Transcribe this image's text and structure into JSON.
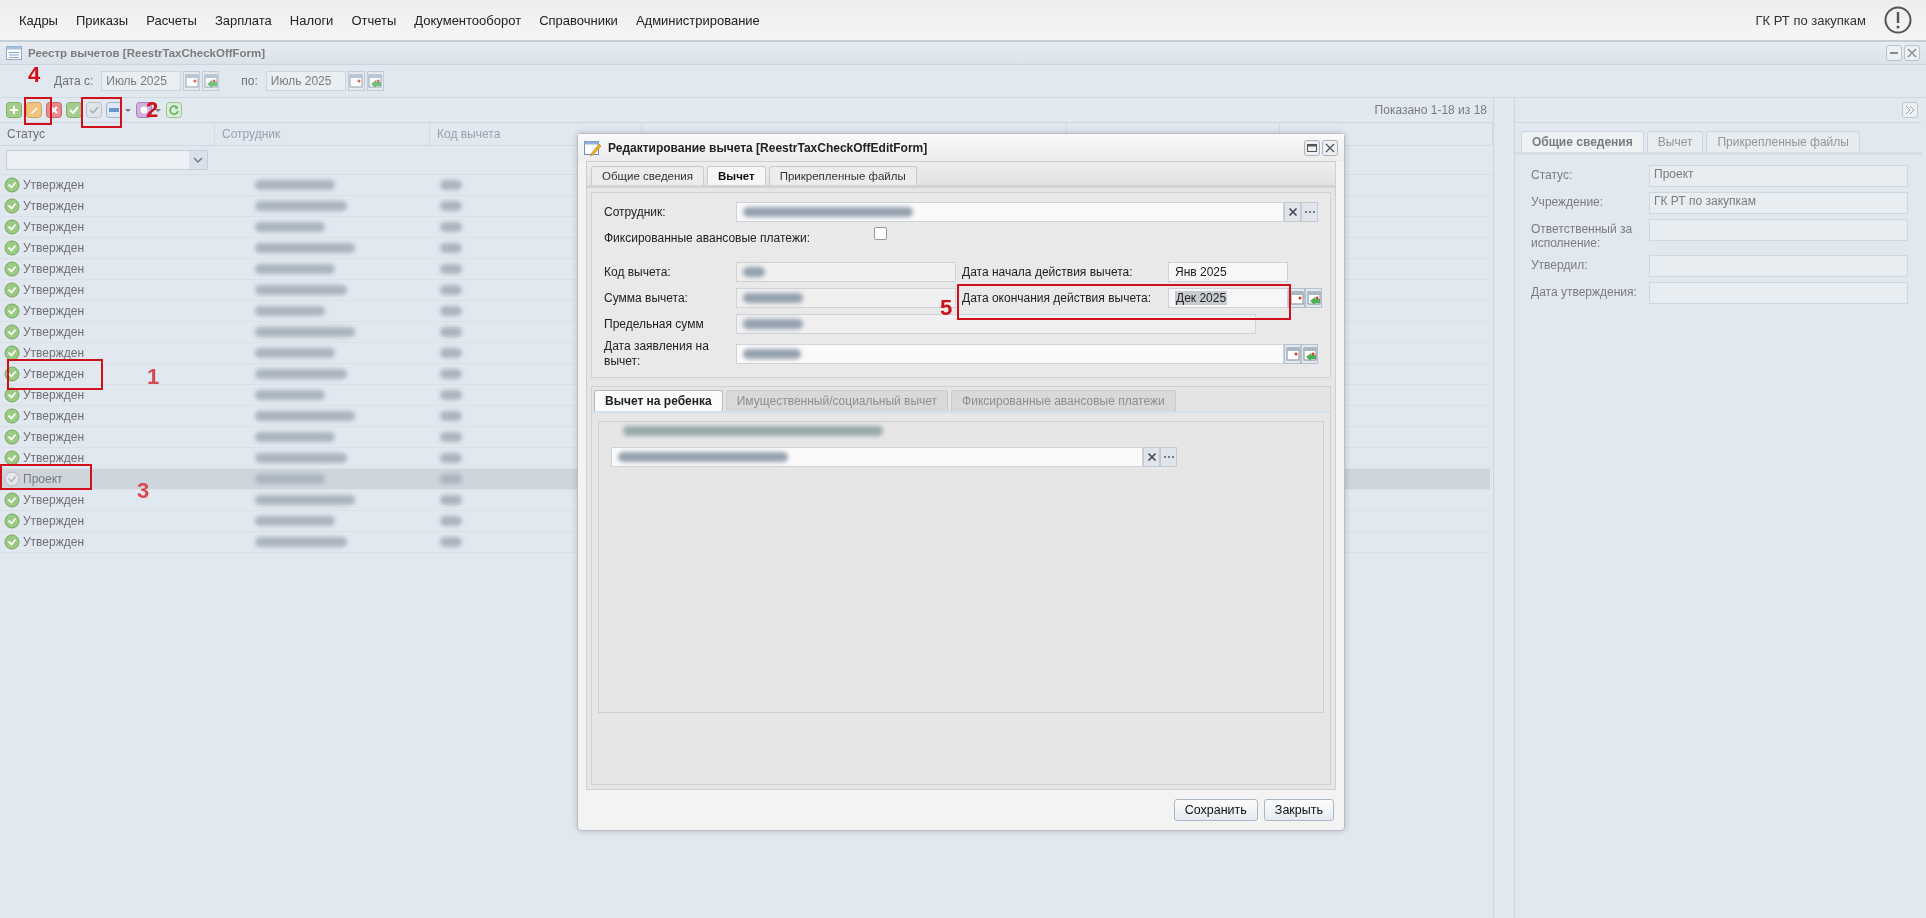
{
  "menu": {
    "items": [
      "Кадры",
      "Приказы",
      "Расчеты",
      "Зарплата",
      "Налоги",
      "Отчеты",
      "Документооборот",
      "Справочники",
      "Администрирование"
    ],
    "org": "ГК РТ по закупкам"
  },
  "registry_window": {
    "title": "Реестр вычетов [ReestrTaxCheckOffForm]",
    "date_from_label": "Дата с:",
    "date_from": "Июль 2025",
    "date_to_label": "по:",
    "date_to": "Июль 2025",
    "paging": "Показано 1-18 из 18",
    "columns": [
      "Статус",
      "Сотрудник",
      "Код вычета"
    ],
    "rows": [
      {
        "status": "Утвержден",
        "kind": "approved",
        "selected": false
      },
      {
        "status": "Утвержден",
        "kind": "approved",
        "selected": false
      },
      {
        "status": "Утвержден",
        "kind": "approved",
        "selected": false
      },
      {
        "status": "Утвержден",
        "kind": "approved",
        "selected": false
      },
      {
        "status": "Утвержден",
        "kind": "approved",
        "selected": false
      },
      {
        "status": "Утвержден",
        "kind": "approved",
        "selected": false
      },
      {
        "status": "Утвержден",
        "kind": "approved",
        "selected": false
      },
      {
        "status": "Утвержден",
        "kind": "approved",
        "selected": false
      },
      {
        "status": "Утвержден",
        "kind": "approved",
        "selected": false
      },
      {
        "status": "Утвержден",
        "kind": "approved",
        "selected": false
      },
      {
        "status": "Утвержден",
        "kind": "approved",
        "selected": false
      },
      {
        "status": "Утвержден",
        "kind": "approved",
        "selected": false
      },
      {
        "status": "Утвержден",
        "kind": "approved",
        "selected": false
      },
      {
        "status": "Утвержден",
        "kind": "approved",
        "selected": false
      },
      {
        "status": "Проект",
        "kind": "draft",
        "selected": true
      },
      {
        "status": "Утвержден",
        "kind": "approved",
        "selected": false
      },
      {
        "status": "Утвержден",
        "kind": "approved",
        "selected": false
      },
      {
        "status": "Утвержден",
        "kind": "approved",
        "selected": false
      }
    ]
  },
  "side_panel": {
    "tabs": [
      {
        "label": "Общие сведения",
        "selected": true
      },
      {
        "label": "Вычет",
        "selected": false
      },
      {
        "label": "Прикрепленные файлы",
        "selected": false
      }
    ],
    "fields": [
      {
        "label": "Статус:",
        "value": "Проект"
      },
      {
        "label": "Учреждение:",
        "value": "ГК РТ по закупкам"
      },
      {
        "label": "Ответственный за исполнение:"
      },
      {
        "label": "Утвердил:"
      },
      {
        "label": "Дата утверждения:"
      }
    ]
  },
  "dialog": {
    "title": "Редактирование вычета [ReestrTaxCheckOffEditForm]",
    "tabs": [
      {
        "label": "Общие сведения",
        "selected": false
      },
      {
        "label": "Вычет",
        "selected": true
      },
      {
        "label": "Прикрепленные файлы",
        "selected": false
      }
    ],
    "employee_label": "Сотрудник:",
    "fixed_label": "Фиксированные авансовые платежи:",
    "fixed_checked": false,
    "code_label": "Код вычета:",
    "sum_label": "Сумма вычета:",
    "limit_label": "Предельная сумм",
    "application_label": "Дата заявления на вычет:",
    "start_label": "Дата начала действия вычета:",
    "start_value": "Янв 2025",
    "end_label": "Дата окончания действия вычета:",
    "end_value": "Дек 2025",
    "subtabs": [
      {
        "label": "Вычет на ребенка",
        "selected": true,
        "disabled": false
      },
      {
        "label": "Имущественный/социальный вычет",
        "selected": false,
        "disabled": true
      },
      {
        "label": "Фиксированные авансовые платежи",
        "selected": false,
        "disabled": true
      }
    ],
    "buttons": [
      "Сохранить",
      "Закрыть"
    ]
  },
  "annotations": [
    "4",
    "2",
    "1",
    "3",
    "5"
  ]
}
